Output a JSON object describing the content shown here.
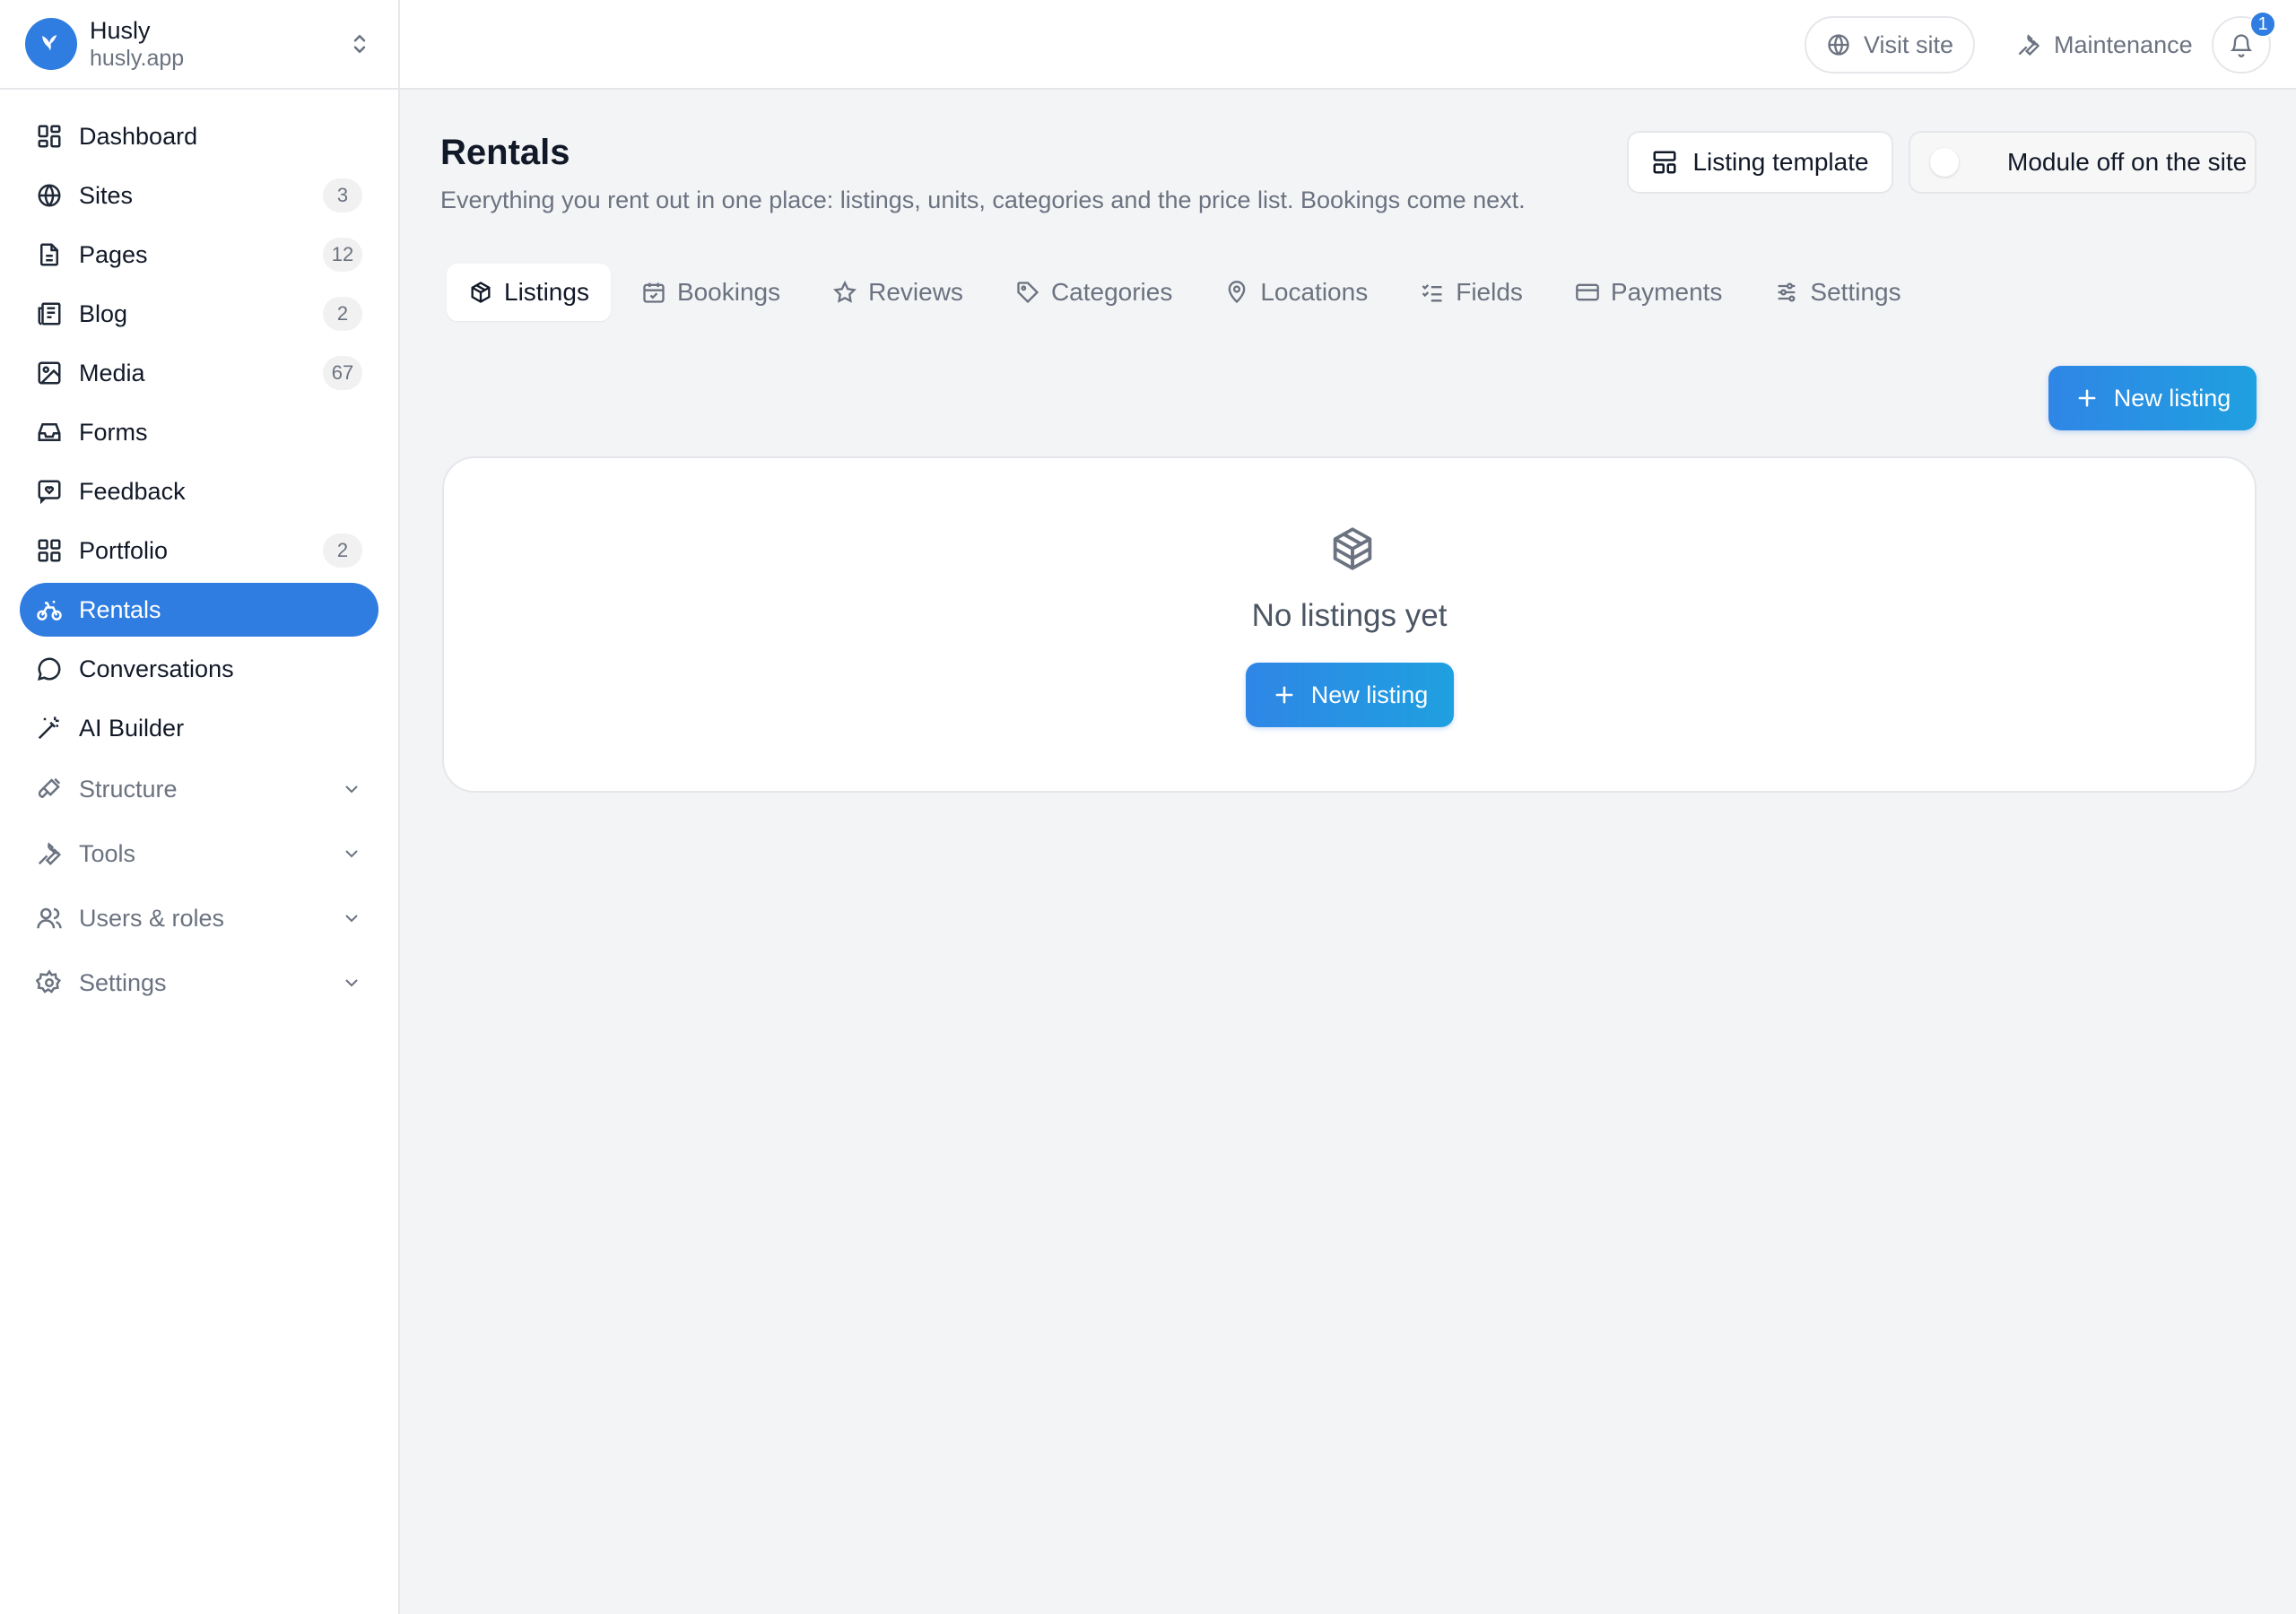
{
  "brand": {
    "name": "Husly",
    "domain": "husly.app"
  },
  "sidebar": {
    "items": [
      {
        "label": "Dashboard",
        "icon": "dashboard-icon",
        "badge": ""
      },
      {
        "label": "Sites",
        "icon": "globe-icon",
        "badge": "3"
      },
      {
        "label": "Pages",
        "icon": "page-icon",
        "badge": "12"
      },
      {
        "label": "Blog",
        "icon": "blog-icon",
        "badge": "2"
      },
      {
        "label": "Media",
        "icon": "image-icon",
        "badge": "67"
      },
      {
        "label": "Forms",
        "icon": "inbox-icon",
        "badge": ""
      },
      {
        "label": "Feedback",
        "icon": "feedback-icon",
        "badge": ""
      },
      {
        "label": "Portfolio",
        "icon": "grid-icon",
        "badge": "2"
      },
      {
        "label": "Rentals",
        "icon": "bike-icon",
        "badge": "",
        "active": true
      },
      {
        "label": "Conversations",
        "icon": "chat-icon",
        "badge": ""
      },
      {
        "label": "AI Builder",
        "icon": "magic-wand-icon",
        "badge": ""
      }
    ],
    "groups": [
      {
        "label": "Structure",
        "icon": "brush-icon"
      },
      {
        "label": "Tools",
        "icon": "wrench-icon"
      },
      {
        "label": "Users & roles",
        "icon": "users-icon"
      },
      {
        "label": "Settings",
        "icon": "gear-icon"
      }
    ]
  },
  "topbar": {
    "visit_site": "Visit site",
    "maintenance": "Maintenance",
    "notification_count": "1"
  },
  "page": {
    "title": "Rentals",
    "subtitle": "Everything you rent out in one place: listings, units, categories and the price list. Bookings come next.",
    "listing_template": "Listing template",
    "module_status": "Module off on the site",
    "module_enabled": false
  },
  "tabs": [
    {
      "label": "Listings",
      "icon": "box-icon",
      "active": true
    },
    {
      "label": "Bookings",
      "icon": "calendar-icon"
    },
    {
      "label": "Reviews",
      "icon": "star-icon"
    },
    {
      "label": "Categories",
      "icon": "tag-icon"
    },
    {
      "label": "Locations",
      "icon": "map-pin-icon"
    },
    {
      "label": "Fields",
      "icon": "checklist-icon"
    },
    {
      "label": "Payments",
      "icon": "credit-card-icon"
    },
    {
      "label": "Settings",
      "icon": "sliders-icon"
    }
  ],
  "listings": {
    "new_button": "New listing",
    "empty_text": "No listings yet",
    "empty_button": "New listing"
  },
  "colors": {
    "accent": "#2f7de1",
    "background": "#f3f4f6",
    "text": "#111827",
    "muted": "#6b7280"
  }
}
